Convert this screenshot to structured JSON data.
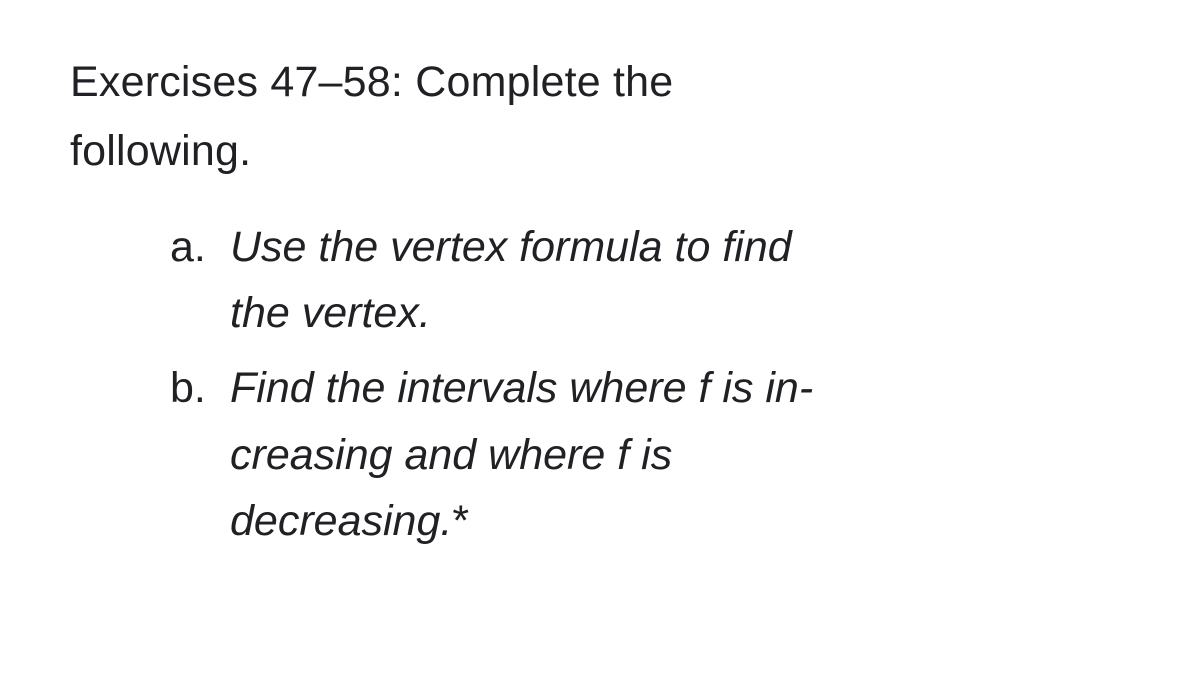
{
  "heading": {
    "line1": "Exercises 47–58: Complete the",
    "line2": "following."
  },
  "items": [
    {
      "label": "a.",
      "text_line1": "Use the vertex formula to find",
      "text_line2": "the vertex."
    },
    {
      "label": "b.",
      "text_line1_part1": "Find the intervals where ",
      "text_line1_fn": "f",
      "text_line1_part2": " is in-",
      "text_line2_part1": "creasing and where ",
      "text_line2_fn": "f",
      "text_line2_part2": " is",
      "text_line3": "decreasing.",
      "asterisk": "*"
    }
  ]
}
